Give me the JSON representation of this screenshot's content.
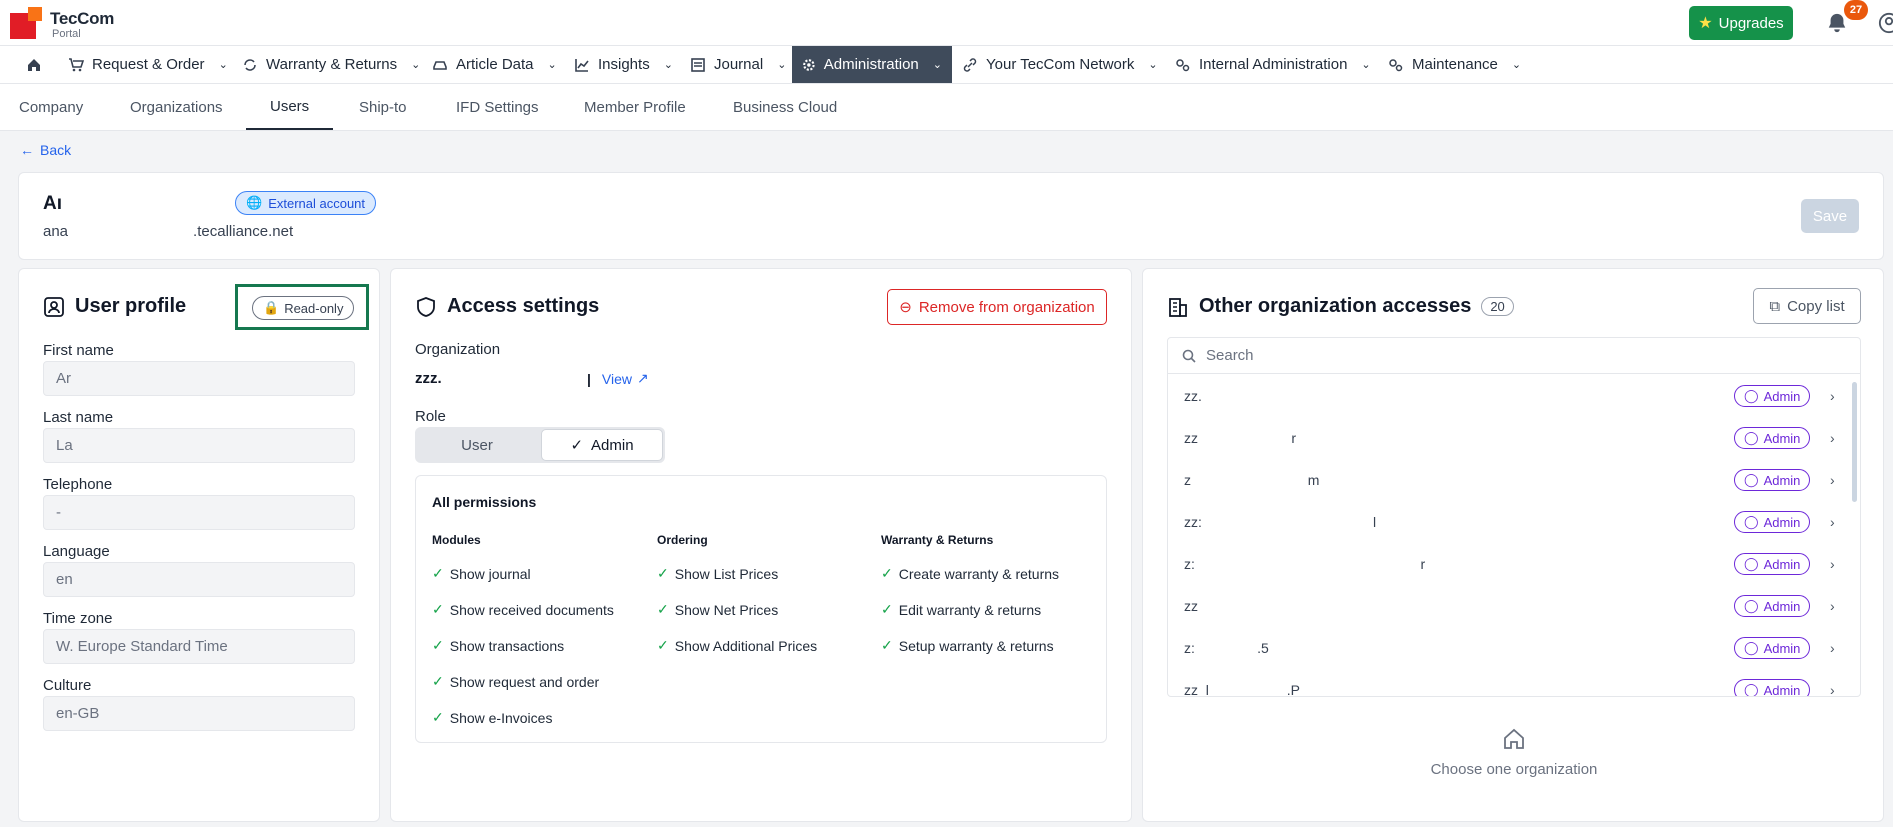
{
  "header": {
    "logo_title": "TecCom",
    "logo_sub": "Portal",
    "upgrades_label": "Upgrades",
    "notification_count": "27"
  },
  "nav": {
    "items": [
      {
        "label": "Request & Order"
      },
      {
        "label": "Warranty & Returns"
      },
      {
        "label": "Article Data"
      },
      {
        "label": "Insights"
      },
      {
        "label": "Journal"
      },
      {
        "label": "Administration"
      },
      {
        "label": "Your TecCom Network"
      },
      {
        "label": "Internal Administration"
      },
      {
        "label": "Maintenance"
      }
    ]
  },
  "tabs": [
    "Company",
    "Organizations",
    "Users",
    "Ship-to",
    "IFD Settings",
    "Member Profile",
    "Business Cloud"
  ],
  "back_label": "Back",
  "user": {
    "name": "Aı",
    "email": "ana                              .tecalliance.net",
    "external_badge": "External account",
    "save_label": "Save"
  },
  "profile": {
    "title": "User profile",
    "readonly_label": "Read-only",
    "fields": [
      {
        "label": "First name",
        "value": "Ar"
      },
      {
        "label": "Last name",
        "value": "La"
      },
      {
        "label": "Telephone",
        "value": "-"
      },
      {
        "label": "Language",
        "value": "en"
      },
      {
        "label": "Time zone",
        "value": "W. Europe Standard Time"
      },
      {
        "label": "Culture",
        "value": "en-GB"
      }
    ]
  },
  "access": {
    "title": "Access settings",
    "remove_label": "Remove from organization",
    "org_label": "Organization",
    "org_name": "zzz.",
    "view_label": "View",
    "role_label": "Role",
    "role_user": "User",
    "role_admin": "Admin",
    "permissions_title": "All permissions",
    "columns": [
      {
        "title": "Modules",
        "items": [
          "Show journal",
          "Show received documents",
          "Show transactions",
          "Show request and order",
          "Show e-Invoices"
        ]
      },
      {
        "title": "Ordering",
        "items": [
          "Show List Prices",
          "Show Net Prices",
          "Show Additional Prices"
        ]
      },
      {
        "title": "Warranty & Returns",
        "items": [
          "Create warranty & returns",
          "Edit warranty & returns",
          "Setup warranty & returns"
        ]
      }
    ]
  },
  "orgs": {
    "title": "Other organization accesses",
    "count": "20",
    "copy_label": "Copy list",
    "search_placeholder": "Search",
    "rows": [
      {
        "name": "zz.",
        "role": "Admin"
      },
      {
        "name": "zz                        r",
        "role": "Admin"
      },
      {
        "name": "z                              m",
        "role": "Admin"
      },
      {
        "name": "zz:                                            l",
        "role": "Admin"
      },
      {
        "name": "z:                                                          r",
        "role": "Admin"
      },
      {
        "name": "zz",
        "role": "Admin"
      },
      {
        "name": "z:                .5",
        "role": "Admin"
      },
      {
        "name": "zz_l                    .P",
        "role": "Admin"
      }
    ],
    "choose_label": "Choose one organization"
  },
  "colors": {
    "brand_red": "#e11d26",
    "upgrades_green": "#15924a",
    "nav_active": "#3f4b5b",
    "link_blue": "#2563eb",
    "danger_red": "#dc2626",
    "admin_purple": "#6d28d9",
    "check_green": "#16a34a",
    "highlight_frame": "#16784f"
  }
}
